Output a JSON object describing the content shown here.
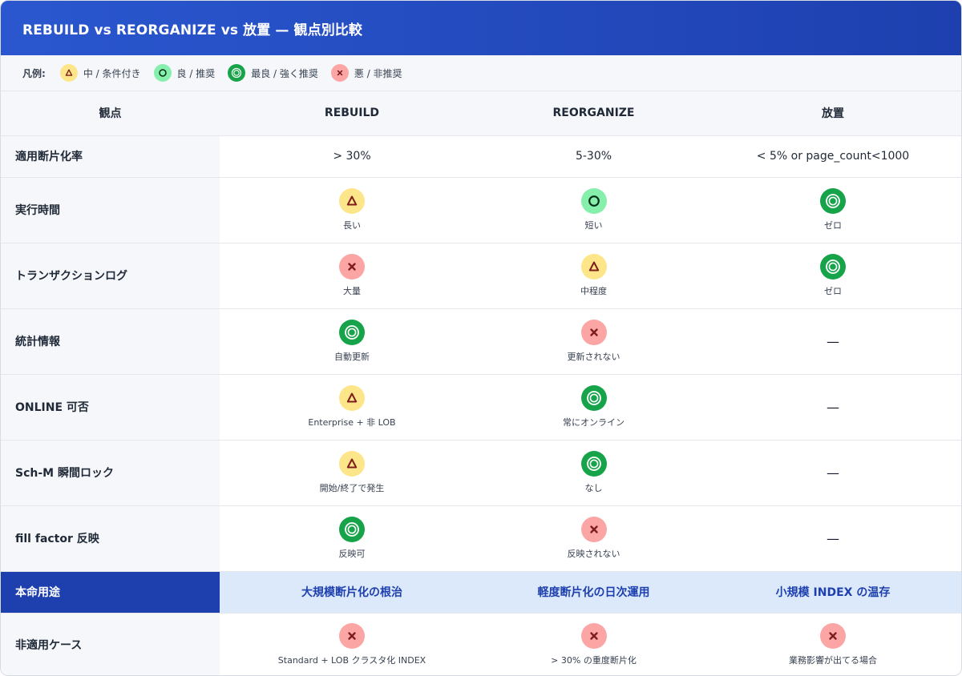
{
  "title": "REBUILD vs REORGANIZE vs 放置 — 観点別比較",
  "legend": {
    "label": "凡例:",
    "items": [
      {
        "icon": "triangle",
        "text": "中 / 条件付き"
      },
      {
        "icon": "circle",
        "text": "良 / 推奨"
      },
      {
        "icon": "double-circle",
        "text": "最良 / 強く推奨"
      },
      {
        "icon": "cross",
        "text": "悪 / 非推奨"
      }
    ]
  },
  "columns": [
    "観点",
    "REBUILD",
    "REORGANIZE",
    "放置"
  ],
  "rows": [
    {
      "label": "適用断片化率",
      "cells": [
        {
          "text": "> 30%"
        },
        {
          "text": "5-30%"
        },
        {
          "text": "< 5% or page_count<1000"
        }
      ]
    },
    {
      "label": "実行時間",
      "cells": [
        {
          "icon": "triangle",
          "note": "長い"
        },
        {
          "icon": "circle",
          "note": "短い"
        },
        {
          "icon": "double-circle",
          "note": "ゼロ"
        }
      ]
    },
    {
      "label": "トランザクションログ",
      "cells": [
        {
          "icon": "cross",
          "note": "大量"
        },
        {
          "icon": "triangle",
          "note": "中程度"
        },
        {
          "icon": "double-circle",
          "note": "ゼロ"
        }
      ]
    },
    {
      "label": "統計情報",
      "cells": [
        {
          "icon": "double-circle",
          "note": "自動更新"
        },
        {
          "icon": "cross",
          "note": "更新されない"
        },
        {
          "text": "—"
        }
      ]
    },
    {
      "label": "ONLINE 可否",
      "cells": [
        {
          "icon": "triangle",
          "note": "Enterprise + 非 LOB"
        },
        {
          "icon": "double-circle",
          "note": "常にオンライン"
        },
        {
          "text": "—"
        }
      ]
    },
    {
      "label": "Sch-M 瞬間ロック",
      "cells": [
        {
          "icon": "triangle",
          "note": "開始/終了で発生"
        },
        {
          "icon": "double-circle",
          "note": "なし"
        },
        {
          "text": "—"
        }
      ]
    },
    {
      "label": "fill factor 反映",
      "cells": [
        {
          "icon": "double-circle",
          "note": "反映可"
        },
        {
          "icon": "cross",
          "note": "反映されない"
        },
        {
          "text": "—"
        }
      ]
    }
  ],
  "purpose": {
    "label": "本命用途",
    "cells": [
      "大規模断片化の根治",
      "軽度断片化の日次運用",
      "小規模 INDEX の温存"
    ]
  },
  "nonuse": {
    "label": "非適用ケース",
    "cells": [
      {
        "icon": "cross",
        "note": "Standard + LOB クラスタ化 INDEX"
      },
      {
        "icon": "cross",
        "note": "> 30% の重度断片化"
      },
      {
        "icon": "cross",
        "note": "業務影響が出てる場合"
      }
    ]
  },
  "colors": {
    "header_bg": "#2450c9",
    "accent": "#1e40af",
    "triangle_bg": "#fde68a",
    "circle_bg": "#86efac",
    "double_bg": "#16a34a",
    "cross_bg": "#fca5a5"
  }
}
